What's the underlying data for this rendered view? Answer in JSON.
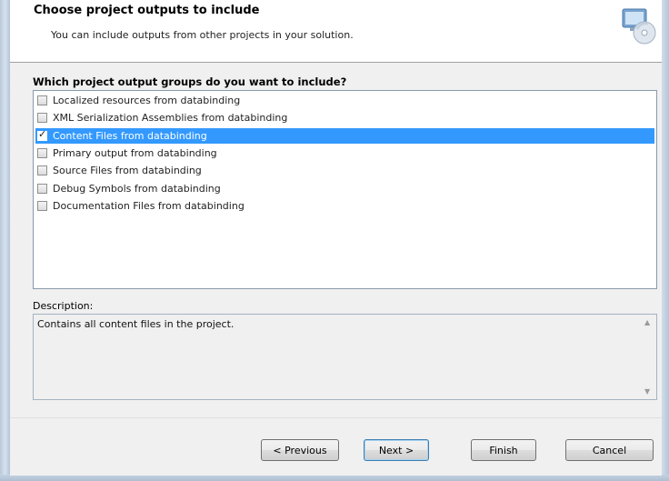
{
  "header": {
    "title": "Choose project outputs to include",
    "subtitle": "You can include outputs from other projects in your solution.",
    "icon": "setup-wizard-icon"
  },
  "main": {
    "question": "Which project output groups do you want to include?",
    "items": [
      {
        "label": "Localized resources from databinding",
        "checked": false,
        "selected": false
      },
      {
        "label": "XML Serialization Assemblies from databinding",
        "checked": false,
        "selected": false
      },
      {
        "label": "Content Files from databinding",
        "checked": true,
        "selected": true
      },
      {
        "label": "Primary output from databinding",
        "checked": false,
        "selected": false
      },
      {
        "label": "Source Files from databinding",
        "checked": false,
        "selected": false
      },
      {
        "label": "Debug Symbols from databinding",
        "checked": false,
        "selected": false
      },
      {
        "label": "Documentation Files from databinding",
        "checked": false,
        "selected": false
      }
    ],
    "description_label": "Description:",
    "description_text": "Contains all content files in the project."
  },
  "footer": {
    "previous_label": "< Previous",
    "next_label": "Next >",
    "finish_label": "Finish",
    "cancel_label": "Cancel"
  },
  "colors": {
    "selection": "#3399ff",
    "panel": "#f0f0f0"
  }
}
